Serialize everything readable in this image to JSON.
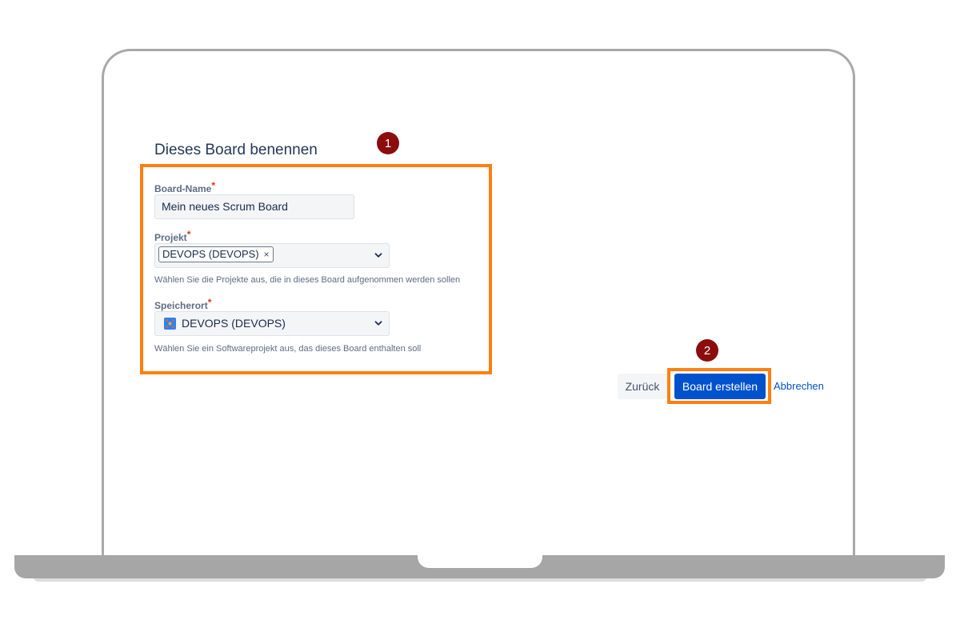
{
  "colors": {
    "highlight": "#ff7f0e",
    "marker": "#8b0d0d",
    "primary_button": "#0052cc",
    "required": "#de350b"
  },
  "markers": [
    "1",
    "2"
  ],
  "page_title": "Dieses Board benennen",
  "form": {
    "board_name": {
      "label": "Board-Name",
      "required_mark": "*",
      "value": "Mein neues Scrum Board"
    },
    "projekt": {
      "label": "Projekt",
      "required_mark": "*",
      "selected_chip": "DEVOPS (DEVOPS)",
      "chip_remove": "×",
      "help": "Wählen Sie die Projekte aus, die in dieses Board aufgenommen werden sollen"
    },
    "speicherort": {
      "label": "Speicherort",
      "required_mark": "*",
      "value": "DEVOPS (DEVOPS)",
      "icon": "project-icon",
      "help": "Wählen Sie ein Softwareprojekt aus, das dieses Board enthalten soll"
    }
  },
  "actions": {
    "back_label": "Zurück",
    "create_label": "Board erstellen",
    "cancel_label": "Abbrechen"
  }
}
